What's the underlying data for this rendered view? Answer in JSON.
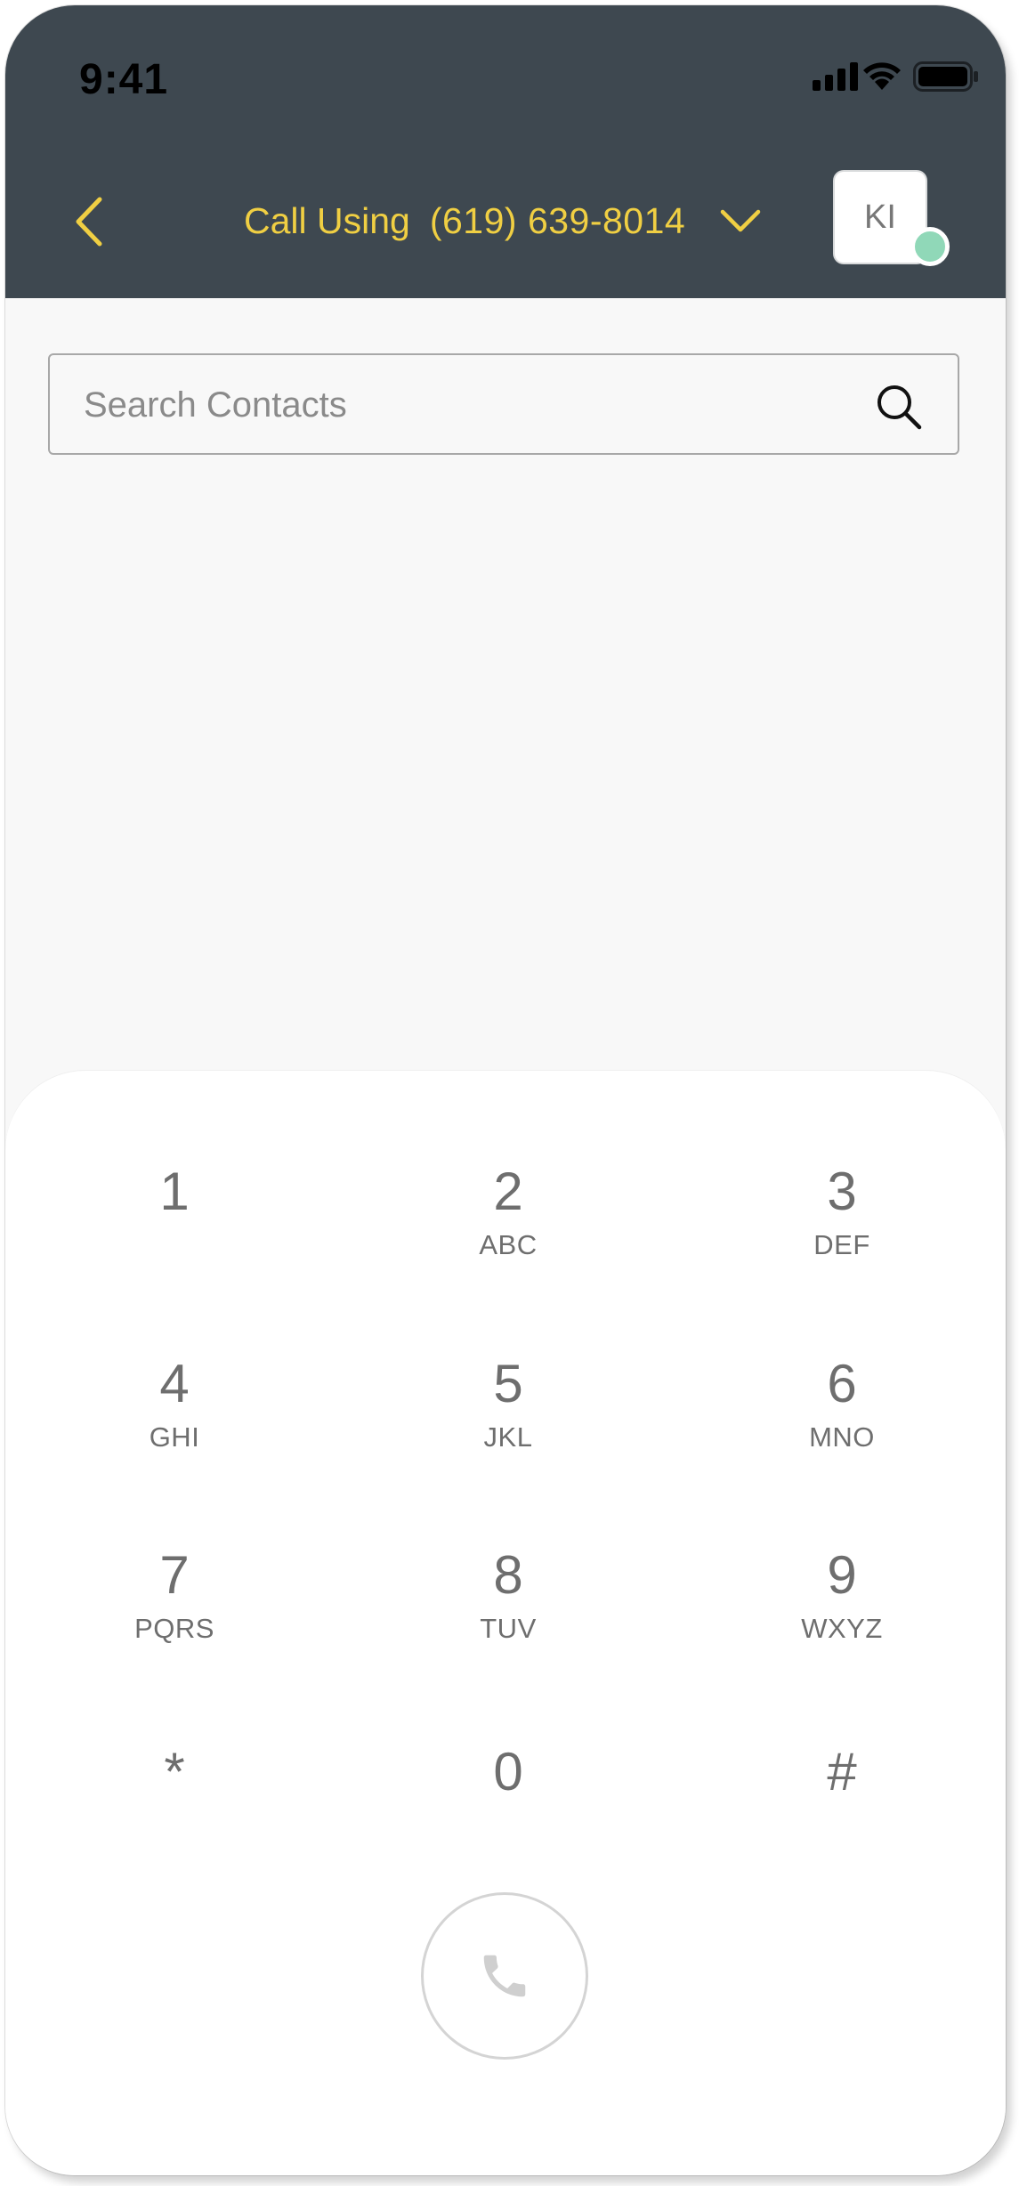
{
  "status_bar": {
    "time": "9:41",
    "icons": [
      "signal-icon",
      "wifi-icon",
      "battery-icon"
    ]
  },
  "header": {
    "back_icon": "chevron-left-icon",
    "call_using_label": "Call Using",
    "call_using_number": "(619) 639-8014",
    "dropdown_icon": "chevron-down-icon",
    "avatar_initials": "KI",
    "presence_status_color": "#90d8b8",
    "background_color": "#3e4850",
    "accent_color": "#f0cf43"
  },
  "search": {
    "placeholder": "Search Contacts",
    "value": "",
    "icon": "search-icon"
  },
  "dialpad": {
    "keys": [
      {
        "digit": "1",
        "letters": ""
      },
      {
        "digit": "2",
        "letters": "ABC"
      },
      {
        "digit": "3",
        "letters": "DEF"
      },
      {
        "digit": "4",
        "letters": "GHI"
      },
      {
        "digit": "5",
        "letters": "JKL"
      },
      {
        "digit": "6",
        "letters": "MNO"
      },
      {
        "digit": "7",
        "letters": "PQRS"
      },
      {
        "digit": "8",
        "letters": "TUV"
      },
      {
        "digit": "9",
        "letters": "WXYZ"
      },
      {
        "digit": "*",
        "letters": ""
      },
      {
        "digit": "0",
        "letters": ""
      },
      {
        "digit": "#",
        "letters": ""
      }
    ],
    "call_icon": "phone-icon"
  }
}
